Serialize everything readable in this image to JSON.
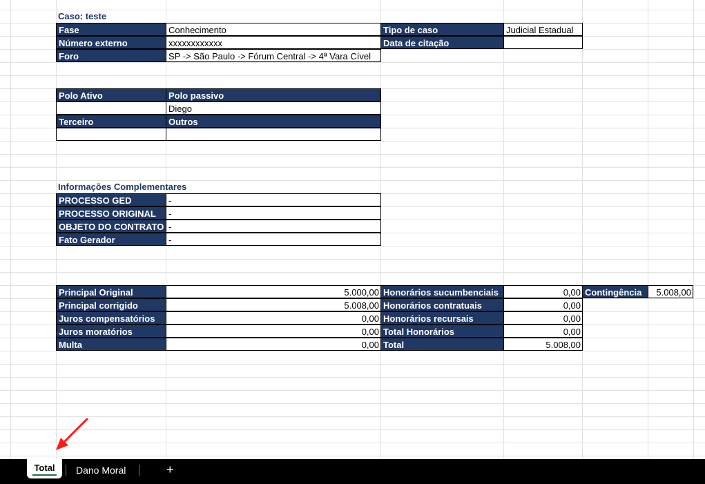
{
  "case": {
    "title": "Caso: teste"
  },
  "info": {
    "fase_label": "Fase",
    "fase_value": "Conhecimento",
    "numero_label": "Número externo",
    "numero_value": "xxxxxxxxxxxx",
    "foro_label": "Foro",
    "foro_value": "SP -> São Paulo -> Fórum Central -> 4ª Vara Cível",
    "tipo_label": "Tipo de caso",
    "tipo_value": "Judicial Estadual",
    "data_citacao_label": "Data de citação",
    "data_citacao_value": ""
  },
  "parties": {
    "polo_ativo_label": "Polo Ativo",
    "polo_passivo_label": "Polo passivo",
    "polo_ativo_value": "",
    "polo_passivo_value": "Diego",
    "terceiro_label": "Terceiro",
    "outros_label": "Outros",
    "terceiro_value": "",
    "outros_value": ""
  },
  "complementares": {
    "title": "Informações Complementares",
    "rows": [
      {
        "label": "PROCESSO GED",
        "value": "-"
      },
      {
        "label": "PROCESSO ORIGINAL",
        "value": "-"
      },
      {
        "label": "OBJETO DO CONTRATO",
        "value": "-"
      },
      {
        "label": "Fato Gerador",
        "value": "-"
      }
    ]
  },
  "values": {
    "left": [
      {
        "label": "Principal Original",
        "value": "5.000,00"
      },
      {
        "label": "Principal corrigido",
        "value": "5.008,00"
      },
      {
        "label": "Juros compensatórios",
        "value": "0,00"
      },
      {
        "label": "Juros moratórios",
        "value": "0,00"
      },
      {
        "label": "Multa",
        "value": "0,00"
      }
    ],
    "right": [
      {
        "label": "Honorários sucumbenciais",
        "value": "0,00"
      },
      {
        "label": "Honorários contratuais",
        "value": "0,00"
      },
      {
        "label": "Honorários recursais",
        "value": "0,00"
      },
      {
        "label": "Total Honorários",
        "value": "0,00"
      },
      {
        "label": "Total",
        "value": "5.008,00"
      }
    ],
    "contingencia_label": "Contingência",
    "contingencia_value": "5.008,00"
  },
  "sheet_tabs": {
    "active": "Total",
    "other": "Dano Moral",
    "add_label": "+"
  },
  "colors": {
    "header_bg": "#203864",
    "title_text": "#1f3864",
    "active_tab_underline": "#1e7145"
  }
}
